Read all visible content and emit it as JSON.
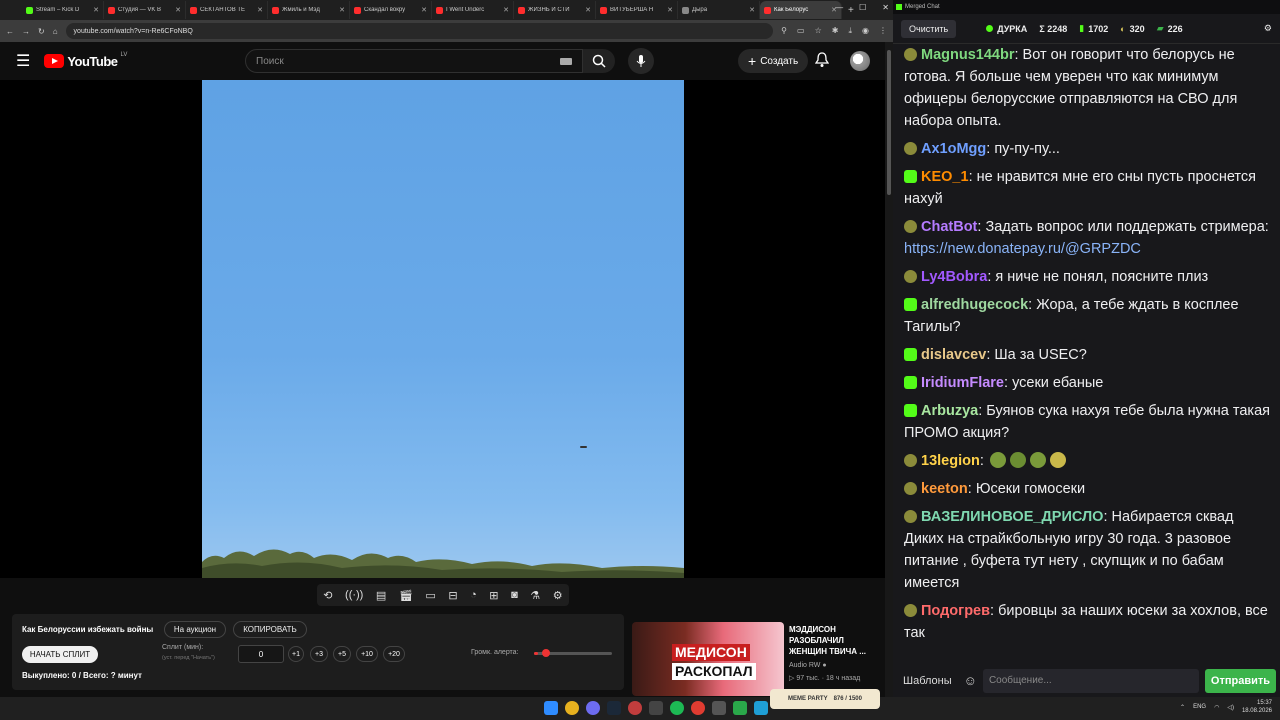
{
  "tabs": [
    {
      "title": "Stream – Kick D",
      "color": "#53fc18"
    },
    {
      "title": "Студия — VK В",
      "color": "#ff2d2d"
    },
    {
      "title": "СЕКТАНТОВ ТЕ",
      "color": "#ff2d2d"
    },
    {
      "title": "Жмиль и Мэд",
      "color": "#ff2d2d"
    },
    {
      "title": "Скандал вокру",
      "color": "#ff2d2d"
    },
    {
      "title": "I Went Underc",
      "color": "#ff2d2d"
    },
    {
      "title": "ЖИЗНЬ И СТИ",
      "color": "#ff2d2d"
    },
    {
      "title": "ВИТУБЕРША Н",
      "color": "#ff2d2d"
    },
    {
      "title": "Дыра",
      "color": "#888888"
    },
    {
      "title": "Как Белорус",
      "color": "#ff2d2d"
    }
  ],
  "address": {
    "url": "youtube.com/watch?v=n-Re6CFoNBQ"
  },
  "youtube": {
    "logo_text": "YouTube",
    "region": "LV",
    "search_placeholder": "Поиск",
    "create_label": "Создать"
  },
  "toolbar_icons": [
    "repeat-icon",
    "broadcast-icon",
    "playlist-icon",
    "clapper-icon",
    "cinema-icon",
    "minimize-icon",
    "speed-icon",
    "add-icon",
    "screenshot-icon",
    "flask-icon",
    "settings-icon"
  ],
  "panel": {
    "title": "Как Белоруссии избежать войны",
    "auction_label": "На аукцион",
    "copy_label": "КОПИРОВАТЬ",
    "start_label": "НАЧАТЬ СПЛИТ",
    "split_label": "Сплит (мин):",
    "split_hint": "(уст. перед \"Начать\")",
    "split_value": "0",
    "increments": [
      "+1",
      "+3",
      "+5",
      "+10",
      "+20"
    ],
    "volume_label": "Громк. алерта:",
    "volume_level": 0.05,
    "total_text": "Выкуплено: 0 / Всего: ? минут"
  },
  "recommendation": {
    "thumb_line1": "МЕДИСОН",
    "thumb_line2": "РАСКОПАЛ",
    "title": "МЭДДИСОН РАЗОБЛАЧИЛ ЖЕНЩИН ТВИЧА ...",
    "channel": "Audio RW",
    "views": "97 тыс.",
    "age": "18 ч назад"
  },
  "chat": {
    "window_title": "Merged Chat",
    "clear_label": "Очистить",
    "channel": "ДУРКА",
    "stats": {
      "sigma": "Σ 2248",
      "kick": "1702",
      "coins": "320",
      "money": "226"
    },
    "messages": [
      {
        "platform": "tw",
        "user": "Magnus144br",
        "color": "#7fd87f",
        "text": "Вот он говорит что белорусь не готова. Я больше чем уверен что как минимум офицеры белорусские отправляются на СВО для набора опыта."
      },
      {
        "platform": "tw",
        "user": "Ax1oMgg",
        "color": "#6f9fff",
        "text": "пу-пу-пу..."
      },
      {
        "platform": "kick",
        "user": "KEO_1",
        "color": "#ff8c00",
        "text": "не нравится мне его сны пусть проснется нахуй"
      },
      {
        "platform": "tw",
        "user": "ChatBot",
        "color": "#b57bff",
        "text": "Задать вопрос или поддержать стримера:",
        "link": "https://new.donatepay.ru/@GRPZDC"
      },
      {
        "platform": "tw",
        "user": "Ly4Bobra",
        "color": "#a259ff",
        "text": "я ниче не понял, поясните плиз"
      },
      {
        "platform": "kick",
        "user": "alfredhugecock",
        "color": "#9fd8a0",
        "text": "Жора, а тебе ждать в косплее Тагилы?"
      },
      {
        "platform": "kick",
        "user": "dislavcev",
        "color": "#e8c88a",
        "text": "Ша за USEC?"
      },
      {
        "platform": "kick",
        "user": "IridiumFlare",
        "color": "#c58bff",
        "text": "усеки ебаные"
      },
      {
        "platform": "kick",
        "user": "Arbuzya",
        "color": "#a8e6a0",
        "text": "Буянов сука нахуя тебе была нужна такая ПРОМО акция?"
      },
      {
        "platform": "tw",
        "user": "13legion",
        "color": "#ffd24a",
        "text": ""
      },
      {
        "platform": "tw",
        "user": "keeton",
        "color": "#ff9a3c",
        "text": "Юсеки гомосеки"
      },
      {
        "platform": "tw",
        "user": "ВАЗЕЛИНОВОЕ_ДРИСЛО",
        "color": "#7fd8b0",
        "text": "Набирается сквад Диких на страйкбольную игру 30 года. 3 разовое питание , буфета тут нету , скупщик и по бабам имеется"
      },
      {
        "platform": "tw",
        "user": "Подогрев",
        "color": "#ff6b6b",
        "text": "бировцы за наших юсеки за хохлов, все так"
      }
    ],
    "templates_label": "Шаблоны",
    "input_placeholder": "Сообщение...",
    "send_label": "Отправить"
  },
  "taskbar": {
    "party_label": "MEME PARTY",
    "party_count": "876 / 1500",
    "lang": "ENG",
    "time": "15:37",
    "date": "18.08.2026"
  }
}
